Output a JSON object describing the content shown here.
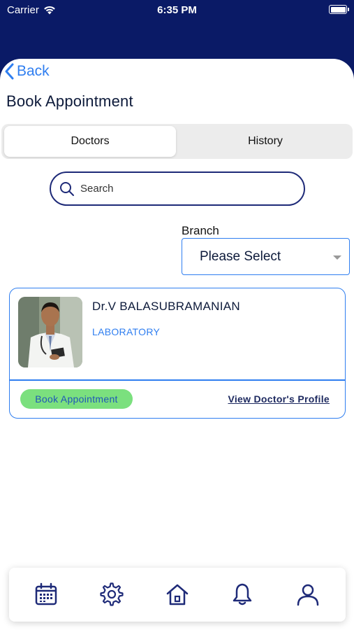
{
  "status_bar": {
    "carrier": "Carrier",
    "time": "6:35 PM"
  },
  "nav": {
    "back_label": "Back",
    "title": "Book Appointment"
  },
  "tabs": [
    {
      "label": "Doctors",
      "active": true
    },
    {
      "label": "History",
      "active": false
    }
  ],
  "search": {
    "placeholder": "Search",
    "value": ""
  },
  "branch": {
    "label": "Branch",
    "selected": "Please Select"
  },
  "doctors": [
    {
      "name": "Dr.V BALASUBRAMANIAN",
      "department": "LABORATORY",
      "book_label": "Book Appointment",
      "profile_label": "View Doctor's Profile"
    }
  ],
  "bottom_tabs": [
    {
      "icon": "calendar-icon"
    },
    {
      "icon": "gear-icon"
    },
    {
      "icon": "home-icon"
    },
    {
      "icon": "bell-icon"
    },
    {
      "icon": "user-icon"
    }
  ],
  "colors": {
    "header_navy": "#0a1a66",
    "accent_blue": "#2f7ef0",
    "book_green": "#7be07e",
    "icon_navy": "#1e2a78"
  }
}
